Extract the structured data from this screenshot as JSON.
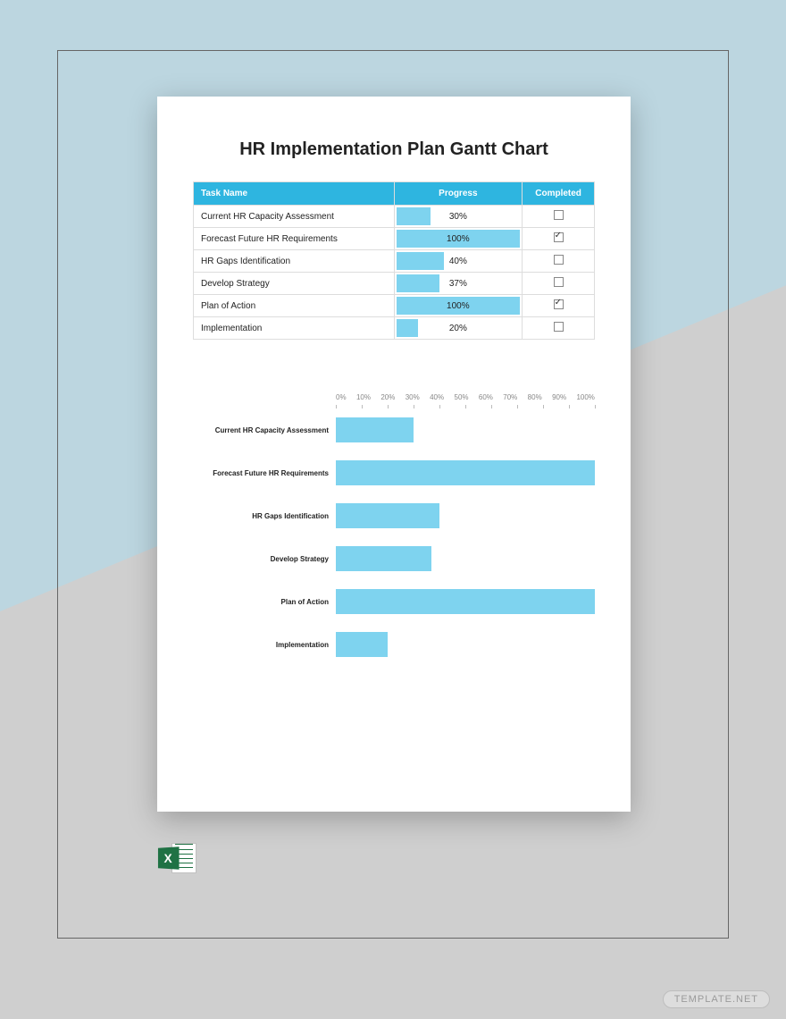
{
  "title": "HR Implementation Plan Gantt Chart",
  "table": {
    "headers": {
      "task": "Task Name",
      "progress": "Progress",
      "completed": "Completed"
    },
    "rows": [
      {
        "task": "Current HR Capacity Assessment",
        "progress": 30,
        "progress_label": "30%",
        "completed": false
      },
      {
        "task": "Forecast Future HR Requirements",
        "progress": 100,
        "progress_label": "100%",
        "completed": true
      },
      {
        "task": "HR Gaps Identification",
        "progress": 40,
        "progress_label": "40%",
        "completed": false
      },
      {
        "task": "Develop Strategy",
        "progress": 37,
        "progress_label": "37%",
        "completed": false
      },
      {
        "task": "Plan of Action",
        "progress": 100,
        "progress_label": "100%",
        "completed": true
      },
      {
        "task": "Implementation",
        "progress": 20,
        "progress_label": "20%",
        "completed": false
      }
    ]
  },
  "chart_data": {
    "type": "bar",
    "orientation": "horizontal",
    "title": "",
    "xlabel": "",
    "ylabel": "",
    "xlim": [
      0,
      100
    ],
    "ticks": [
      "0%",
      "10%",
      "20%",
      "30%",
      "40%",
      "50%",
      "60%",
      "70%",
      "80%",
      "90%",
      "100%"
    ],
    "categories": [
      "Current HR Capacity Assessment",
      "Forecast Future HR Requirements",
      "HR Gaps Identification",
      "Develop Strategy",
      "Plan of Action",
      "Implementation"
    ],
    "values": [
      30,
      100,
      40,
      37,
      100,
      20
    ],
    "bar_color": "#7ed3ef"
  },
  "icons": {
    "excel": "X"
  },
  "watermark": "TEMPLATE.NET"
}
